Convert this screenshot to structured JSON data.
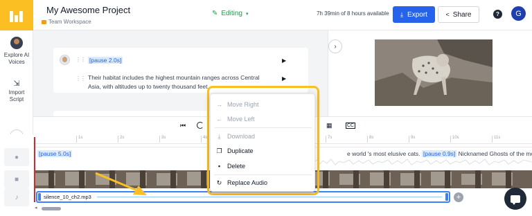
{
  "app": {
    "project_title": "My Awesome Project",
    "workspace": "Team Workspace",
    "mode_label": "Editing",
    "time_available": "7h 39min of 8 hours available",
    "export_label": "Export",
    "share_label": "Share",
    "help_label": "?",
    "user_initial": "G"
  },
  "sidebar": {
    "items": [
      {
        "label": "Explore AI Voices"
      },
      {
        "label": "Import Script"
      }
    ]
  },
  "script": {
    "blocks": [
      {
        "pause_tag": "[pause 2.0s]"
      },
      {
        "text": "Their habitat includes the highest mountain ranges across Central Asia, with altitudes up to twenty thousand feet."
      }
    ]
  },
  "timeline": {
    "ruler_ticks": [
      "1s",
      "2s",
      "3s",
      "4s",
      "5s",
      "6s",
      "7s",
      "8s",
      "9s",
      "10s",
      "11s"
    ],
    "text_track": {
      "pause_start": "[pause 5.0s]",
      "segment_prefix": "e world 's most elusive cats.",
      "pause_mid": "[pause 0.9s]",
      "segment_suffix": "Nicknamed Ghosts of the mountains,"
    },
    "audio_clip_name": "silence_10_ch2.mp3"
  },
  "context_menu": {
    "items": [
      {
        "label": "Move Right",
        "icon": "arrow-right-icon",
        "enabled": false
      },
      {
        "label": "Move Left",
        "icon": "arrow-left-icon",
        "enabled": false
      },
      {
        "label": "Download",
        "icon": "download-icon",
        "enabled": false
      },
      {
        "label": "Duplicate",
        "icon": "duplicate-icon",
        "enabled": true
      },
      {
        "label": "Delete",
        "icon": "trash-icon",
        "enabled": true
      },
      {
        "label": "Replace Audio",
        "icon": "replace-icon",
        "enabled": true
      }
    ]
  },
  "colors": {
    "brand": "#fbbf24",
    "primary": "#2563eb",
    "editing": "#16a34a",
    "playhead": "#dc2626",
    "highlight": "#fbbf24"
  }
}
